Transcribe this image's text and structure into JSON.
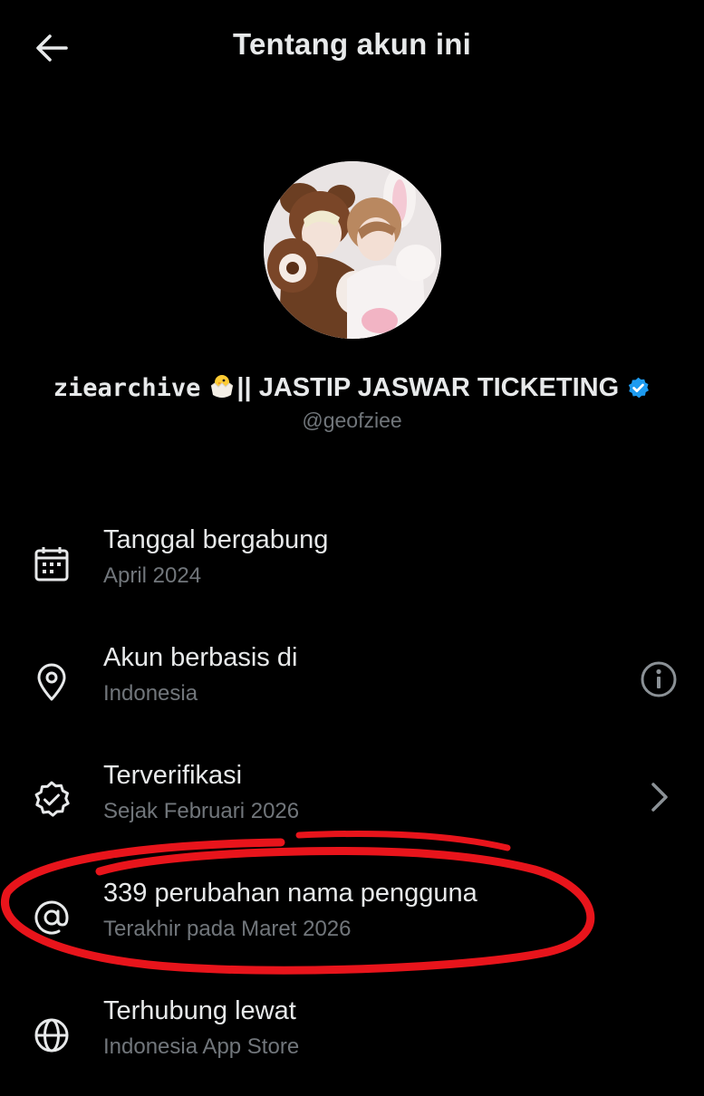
{
  "header": {
    "title": "Tentang akun ini",
    "back_icon": "arrow-left-icon"
  },
  "profile": {
    "name_handle_part": "ziearchive",
    "name_emoji": "hatching-chick-emoji",
    "name_rest": "|| JASTIP JASWAR TICKETING",
    "verified_icon": "verified-badge-icon",
    "handle": "@geofziee"
  },
  "details": [
    {
      "icon": "calendar-icon",
      "label": "Tanggal bergabung",
      "value": "April 2024"
    },
    {
      "icon": "location-pin-icon",
      "label": "Akun berbasis di",
      "value": "Indonesia",
      "trailing_icon": "info-icon"
    },
    {
      "icon": "verified-check-icon",
      "label": "Terverifikasi",
      "value": "Sejak Februari 2026",
      "trailing_icon": "chevron-right-icon"
    },
    {
      "icon": "at-sign-icon",
      "label": "339 perubahan nama pengguna",
      "value": "Terakhir pada Maret 2026"
    },
    {
      "icon": "globe-icon",
      "label": "Terhubung lewat",
      "value": "Indonesia App Store"
    }
  ],
  "colors": {
    "background": "#000000",
    "primary_text": "#e7e9ea",
    "secondary_text": "#71767b",
    "verified_blue": "#1d9bf0",
    "annotation_red": "#e8141b"
  }
}
